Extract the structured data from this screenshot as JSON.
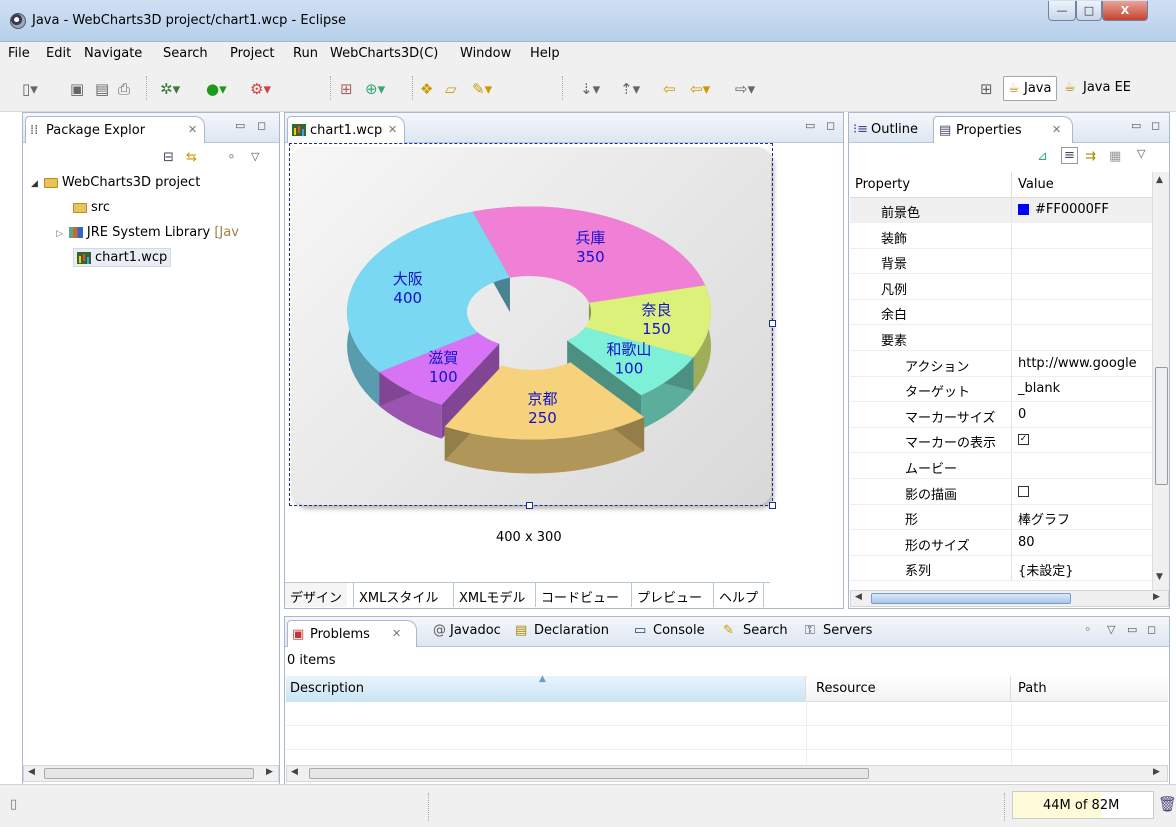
{
  "window": {
    "title": "Java - WebCharts3D project/chart1.wcp - Eclipse",
    "min": "—",
    "max": "□",
    "close": "X"
  },
  "menu": [
    "File",
    "Edit",
    "Navigate",
    "Search",
    "Project",
    "Run",
    "WebCharts3D(C)",
    "Window",
    "Help"
  ],
  "perspectives": {
    "java": "Java",
    "javaee": "Java EE"
  },
  "package_explorer": {
    "tab": "Package Explor",
    "project": "WebCharts3D project",
    "src": "src",
    "jre_name": "JRE System Library",
    "jre_suffix": "[Jav",
    "chart_file": "chart1.wcp"
  },
  "editor": {
    "tab": "chart1.wcp",
    "size_label": "400 x 300",
    "bottom_tabs": [
      "デザイン",
      "XMLスタイル",
      "XMLモデル",
      "コードビュー",
      "プレビュー",
      "ヘルプ"
    ]
  },
  "chart_data": {
    "type": "pie",
    "categories": [
      "兵庫",
      "奈良",
      "和歌山",
      "京都",
      "滋賀",
      "大阪"
    ],
    "values": [
      350,
      150,
      100,
      250,
      100,
      400
    ],
    "colors": [
      "#f07fd6",
      "#dcf17a",
      "#7ff0d8",
      "#f5d27b",
      "#d774f5",
      "#7ad8f2"
    ],
    "exploded": "京都",
    "label_color": "#1111cc"
  },
  "outline_panel": {
    "tab_outline": "Outline",
    "tab_properties": "Properties",
    "col_property": "Property",
    "col_value": "Value",
    "rows": [
      {
        "k": "前景色",
        "v": "#FF0000FF",
        "indent": 1,
        "swatch": "#0000ff"
      },
      {
        "k": "装飾",
        "v": "",
        "indent": 1
      },
      {
        "k": "背景",
        "v": "",
        "indent": 1
      },
      {
        "k": "凡例",
        "v": "",
        "indent": 1
      },
      {
        "k": "余白",
        "v": "",
        "indent": 1
      },
      {
        "k": "要素",
        "v": "",
        "indent": 1
      },
      {
        "k": "アクション",
        "v": "http://www.google",
        "indent": 2
      },
      {
        "k": "ターゲット",
        "v": "_blank",
        "indent": 2
      },
      {
        "k": "マーカーサイズ",
        "v": "0",
        "indent": 2
      },
      {
        "k": "マーカーの表示",
        "v": "",
        "indent": 2,
        "checkbox": true,
        "checked": true
      },
      {
        "k": "ムービー",
        "v": "",
        "indent": 2
      },
      {
        "k": "影の描画",
        "v": "",
        "indent": 2,
        "checkbox": true,
        "checked": false
      },
      {
        "k": "形",
        "v": "棒グラフ",
        "indent": 2
      },
      {
        "k": "形のサイズ",
        "v": "80",
        "indent": 2
      },
      {
        "k": "系列",
        "v": "{未設定}",
        "indent": 2
      }
    ]
  },
  "problems": {
    "tabs": [
      "Problems",
      "Javadoc",
      "Declaration",
      "Console",
      "Search",
      "Servers"
    ],
    "count": "0 items",
    "columns": [
      "Description",
      "Resource",
      "Path"
    ]
  },
  "status": {
    "memory": "44M of 82M"
  }
}
